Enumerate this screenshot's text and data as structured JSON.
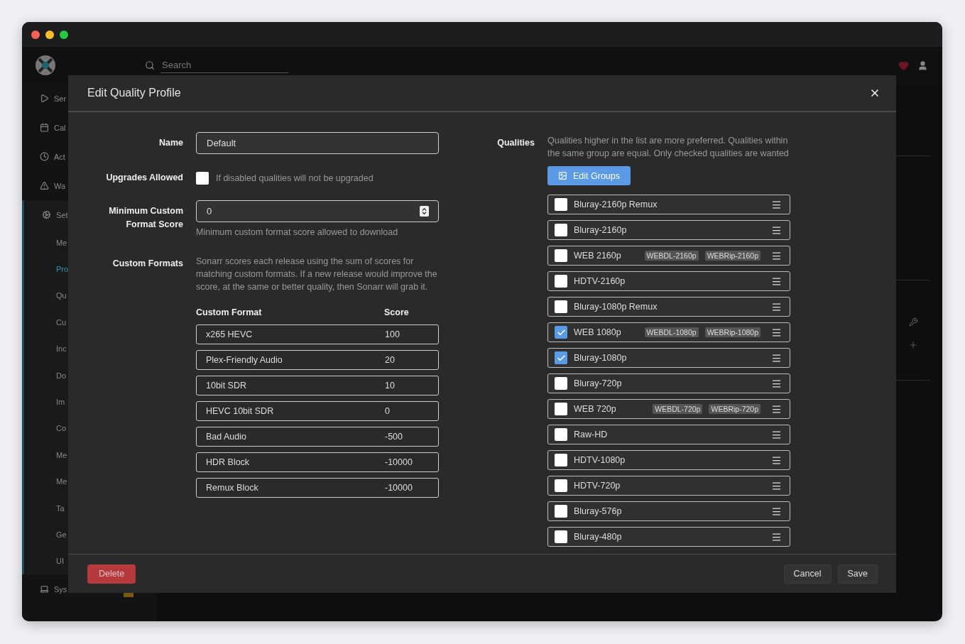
{
  "header": {
    "search": {
      "placeholder": "Search"
    }
  },
  "sidebar": {
    "items": [
      {
        "label": "Ser",
        "selected": false
      },
      {
        "label": "Cal",
        "selected": false
      },
      {
        "label": "Act",
        "selected": false
      },
      {
        "label": "Wa",
        "selected": false
      },
      {
        "label": "Set",
        "selected": true,
        "children": [
          {
            "label": "Me",
            "selected": false
          },
          {
            "label": "Pro",
            "selected": true
          },
          {
            "label": "Qu",
            "selected": false
          },
          {
            "label": "Cu",
            "selected": false
          },
          {
            "label": "Inc",
            "selected": false
          },
          {
            "label": "Do",
            "selected": false
          },
          {
            "label": "Im",
            "selected": false
          },
          {
            "label": "Co",
            "selected": false
          },
          {
            "label": "Me",
            "selected": false
          },
          {
            "label": "Me",
            "selected": false
          },
          {
            "label": "Ta",
            "selected": false
          },
          {
            "label": "Ge",
            "selected": false
          },
          {
            "label": "UI",
            "selected": false
          }
        ]
      },
      {
        "label": "Sys",
        "selected": false
      }
    ]
  },
  "dialog": {
    "title": "Edit Quality Profile",
    "name": {
      "label": "Name",
      "value": "Default"
    },
    "upgrades": {
      "label": "Upgrades Allowed",
      "checked": false,
      "hint": "If disabled qualities will not be upgraded"
    },
    "min_score": {
      "label": "Minimum Custom Format Score",
      "value": "0",
      "hint": "Minimum custom format score allowed to download"
    },
    "custom_formats": {
      "label": "Custom Formats",
      "description": "Sonarr scores each release using the sum of scores for matching custom formats. If a new release would improve the score, at the same or better quality, then Sonarr will grab it.",
      "columns": [
        "Custom Format",
        "Score"
      ],
      "rows": [
        {
          "name": "x265 HEVC",
          "score": "100"
        },
        {
          "name": "Plex-Friendly Audio",
          "score": "20"
        },
        {
          "name": "10bit SDR",
          "score": "10"
        },
        {
          "name": "HEVC 10bit SDR",
          "score": "0"
        },
        {
          "name": "Bad Audio",
          "score": "-500"
        },
        {
          "name": "HDR Block",
          "score": "-10000"
        },
        {
          "name": "Remux Block",
          "score": "-10000"
        }
      ]
    },
    "qualities": {
      "label": "Qualities",
      "description": "Qualities higher in the list are more preferred. Qualities within the same group are equal. Only checked qualities are wanted",
      "edit_button": "Edit Groups",
      "items": [
        {
          "name": "Bluray-2160p Remux",
          "checked": false
        },
        {
          "name": "Bluray-2160p",
          "checked": false
        },
        {
          "name": "WEB 2160p",
          "checked": false,
          "tags": [
            "WEBDL-2160p",
            "WEBRip-2160p"
          ]
        },
        {
          "name": "HDTV-2160p",
          "checked": false
        },
        {
          "name": "Bluray-1080p Remux",
          "checked": false
        },
        {
          "name": "WEB 1080p",
          "checked": true,
          "tags": [
            "WEBDL-1080p",
            "WEBRip-1080p"
          ]
        },
        {
          "name": "Bluray-1080p",
          "checked": true
        },
        {
          "name": "Bluray-720p",
          "checked": false
        },
        {
          "name": "WEB 720p",
          "checked": false,
          "tags": [
            "WEBDL-720p",
            "WEBRip-720p"
          ]
        },
        {
          "name": "Raw-HD",
          "checked": false
        },
        {
          "name": "HDTV-1080p",
          "checked": false
        },
        {
          "name": "HDTV-720p",
          "checked": false
        },
        {
          "name": "Bluray-576p",
          "checked": false
        },
        {
          "name": "Bluray-480p",
          "checked": false
        }
      ]
    },
    "footer": {
      "delete": "Delete",
      "cancel": "Cancel",
      "save": "Save"
    }
  }
}
